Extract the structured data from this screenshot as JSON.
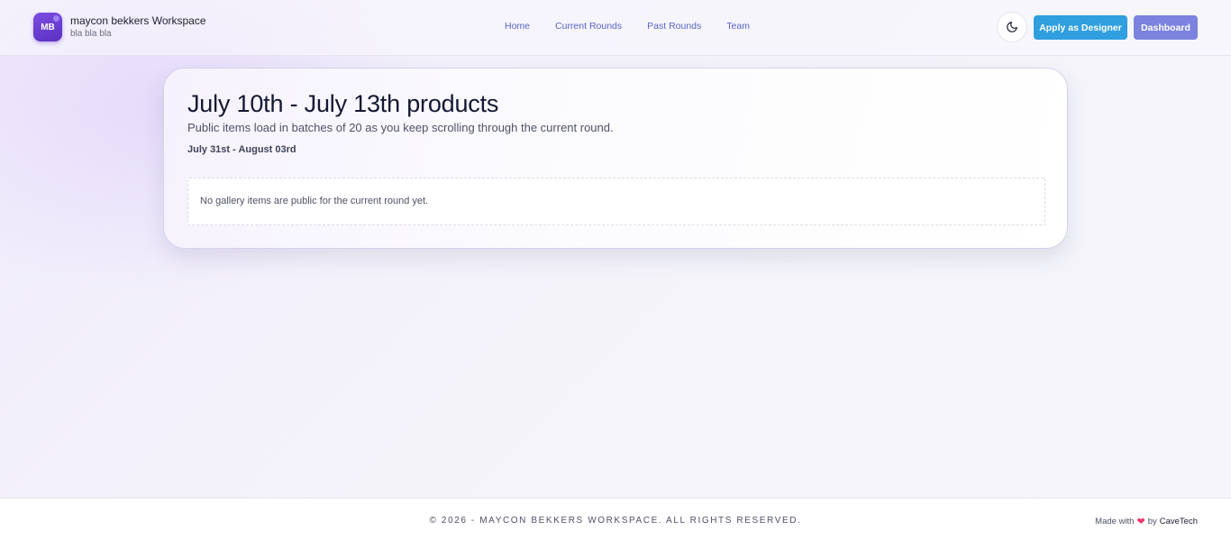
{
  "brand": {
    "initials": "MB",
    "title": "maycon bekkers Workspace",
    "subtitle": "bla bla bla"
  },
  "nav": {
    "items": [
      "Home",
      "Current Rounds",
      "Past Rounds",
      "Team"
    ]
  },
  "header": {
    "theme_icon": "moon-icon",
    "apply_label": "Apply as Designer",
    "dashboard_label": "Dashboard"
  },
  "card": {
    "title": "July 10th - July 13th products",
    "description": "Public items load in batches of 20 as you keep scrolling through the current round.",
    "date_range": "July 31st - August 03rd",
    "empty_message": "No gallery items are public for the current round yet."
  },
  "footer": {
    "copyright": "© 2026 - MAYCON BEKKERS WORKSPACE. ALL RIGHTS RESERVED.",
    "made_with": "Made with",
    "heart_icon": "heart-icon",
    "by": "by",
    "company": "CaveTech"
  },
  "colors": {
    "brand_purple": "#5a2fc2",
    "nav_link": "#5864c6",
    "apply_button": "#2f9fe0",
    "dashboard_button": "#7b83de",
    "heart": "#e8396a"
  }
}
